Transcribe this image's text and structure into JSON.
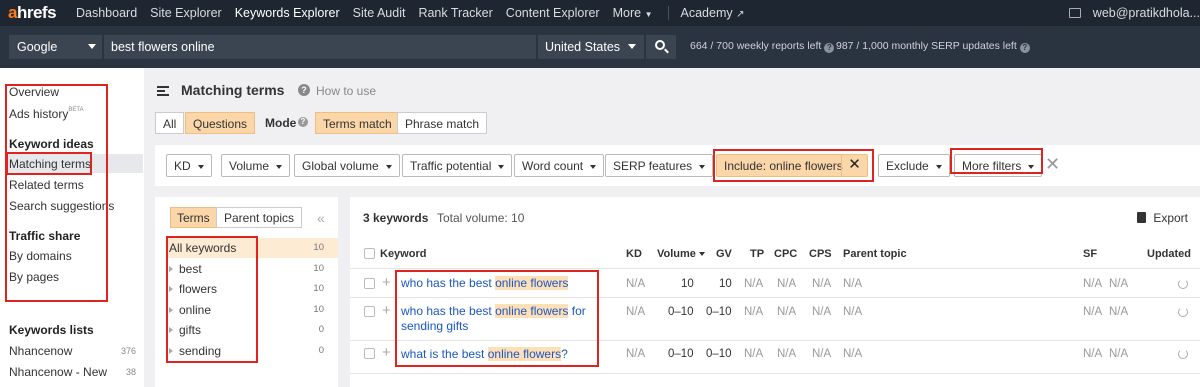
{
  "nav": {
    "logo_a": "a",
    "logo_rest": "hrefs",
    "items": [
      "Dashboard",
      "Site Explorer",
      "Keywords Explorer",
      "Site Audit",
      "Rank Tracker",
      "Content Explorer",
      "More"
    ],
    "academy": "Academy",
    "user": "web@pratikdhola..."
  },
  "search": {
    "engine": "Google",
    "query": "best flowers online",
    "country": "United States",
    "weekly": "664 / 700 weekly reports left",
    "monthly": "987 / 1,000 monthly SERP updates left"
  },
  "sidebar": {
    "overview": "Overview",
    "ads_history": "Ads history",
    "beta": "BETA",
    "ideas_head": "Keyword ideas",
    "matching": "Matching terms",
    "related": "Related terms",
    "suggestions": "Search suggestions",
    "traffic_head": "Traffic share",
    "by_domains": "By domains",
    "by_pages": "By pages",
    "lists_head": "Keywords lists",
    "lists": [
      {
        "name": "Nhancenow",
        "count": "376"
      },
      {
        "name": "Nhancenow - New",
        "count": "38"
      }
    ]
  },
  "header": {
    "title": "Matching terms",
    "help": "?",
    "how_to": "How to use",
    "tab_all": "All",
    "tab_questions": "Questions",
    "mode": "Mode",
    "terms_match": "Terms match",
    "phrase_match": "Phrase match"
  },
  "filters": {
    "kd": "KD",
    "volume": "Volume",
    "global_volume": "Global volume",
    "traffic_potential": "Traffic potential",
    "word_count": "Word count",
    "serp_features": "SERP features",
    "include": "Include: online flowers",
    "exclude": "Exclude",
    "more": "More filters"
  },
  "terms_panel": {
    "tab_terms": "Terms",
    "tab_parent": "Parent topics",
    "rows": [
      {
        "label": "All keywords",
        "count": "10"
      },
      {
        "label": "best",
        "count": "10"
      },
      {
        "label": "flowers",
        "count": "10"
      },
      {
        "label": "online",
        "count": "10"
      },
      {
        "label": "gifts",
        "count": "0"
      },
      {
        "label": "sending",
        "count": "0"
      }
    ]
  },
  "results": {
    "count": "3 keywords",
    "total": "Total volume: 10",
    "export": "Export",
    "headers": {
      "keyword": "Keyword",
      "kd": "KD",
      "volume": "Volume",
      "gv": "GV",
      "tp": "TP",
      "cpc": "CPC",
      "cps": "CPS",
      "parent": "Parent topic",
      "sf": "SF",
      "updated": "Updated"
    },
    "rows": [
      {
        "pre": "who has the best ",
        "hl": "online flowers",
        "post": "",
        "kd": "N/A",
        "volume": "10",
        "gv": "10",
        "tp": "N/A",
        "cpc": "N/A",
        "cps": "N/A",
        "parent": "N/A",
        "sf1": "N/A",
        "sf2": "N/A"
      },
      {
        "pre": "who has the best ",
        "hl": "online flowers",
        "post": " for sending gifts",
        "kd": "N/A",
        "volume": "0–10",
        "gv": "0–10",
        "tp": "N/A",
        "cpc": "N/A",
        "cps": "N/A",
        "parent": "N/A",
        "sf1": "N/A",
        "sf2": "N/A"
      },
      {
        "pre": "what is the best ",
        "hl": "online flowers",
        "post": "?",
        "kd": "N/A",
        "volume": "0–10",
        "gv": "0–10",
        "tp": "N/A",
        "cpc": "N/A",
        "cps": "N/A",
        "parent": "N/A",
        "sf1": "N/A",
        "sf2": "N/A"
      }
    ]
  }
}
